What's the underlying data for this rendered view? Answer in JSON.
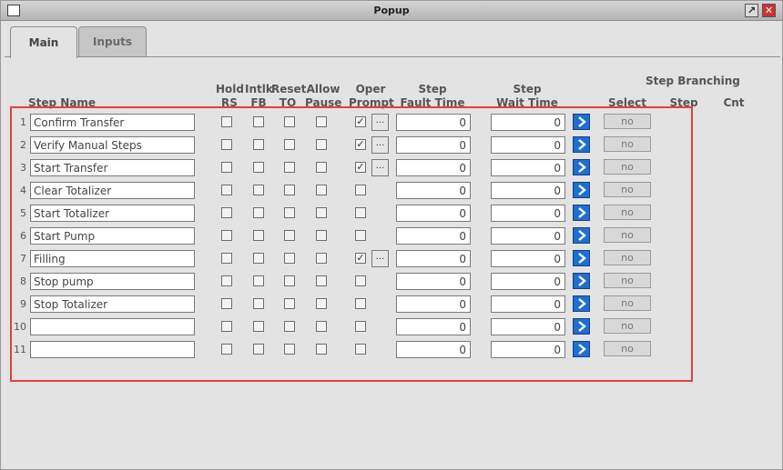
{
  "window": {
    "title": "Popup"
  },
  "tabs": [
    {
      "label": "Main",
      "active": true
    },
    {
      "label": "Inputs",
      "active": false
    }
  ],
  "headers": {
    "step_name": "Step Name",
    "hold": "Hold",
    "rs": "RS",
    "intlk": "Intlk",
    "fb": "FB",
    "reset": "Reset",
    "to": "TO",
    "allow": "Allow",
    "pause": "Pause",
    "oper": "Oper",
    "prompt": "Prompt",
    "step_fault_1": "Step",
    "step_fault_2": "Fault Time",
    "step_wait_1": "Step",
    "step_wait_2": "Wait Time",
    "step_branching": "Step Branching",
    "select": "Select",
    "step": "Step",
    "cnt": "Cnt"
  },
  "rows": [
    {
      "num": "1",
      "name": "Confirm Transfer",
      "oper": true,
      "fault": "0",
      "wait": "0",
      "select": "no"
    },
    {
      "num": "2",
      "name": "Verify Manual Steps",
      "oper": true,
      "fault": "0",
      "wait": "0",
      "select": "no"
    },
    {
      "num": "3",
      "name": "Start Transfer",
      "oper": true,
      "fault": "0",
      "wait": "0",
      "select": "no"
    },
    {
      "num": "4",
      "name": "Clear Totalizer",
      "oper": false,
      "fault": "0",
      "wait": "0",
      "select": "no"
    },
    {
      "num": "5",
      "name": "Start Totalizer",
      "oper": false,
      "fault": "0",
      "wait": "0",
      "select": "no"
    },
    {
      "num": "6",
      "name": "Start Pump",
      "oper": false,
      "fault": "0",
      "wait": "0",
      "select": "no"
    },
    {
      "num": "7",
      "name": "Filling",
      "oper": true,
      "fault": "0",
      "wait": "0",
      "select": "no"
    },
    {
      "num": "8",
      "name": "Stop pump",
      "oper": false,
      "fault": "0",
      "wait": "0",
      "select": "no"
    },
    {
      "num": "9",
      "name": "Stop Totalizer",
      "oper": false,
      "fault": "0",
      "wait": "0",
      "select": "no"
    },
    {
      "num": "10",
      "name": "",
      "oper": false,
      "fault": "0",
      "wait": "0",
      "select": "no"
    },
    {
      "num": "11",
      "name": "",
      "oper": false,
      "fault": "0",
      "wait": "0",
      "select": "no"
    }
  ],
  "colors": {
    "highlight": "#e04040",
    "arrow": "#1e6fd0"
  },
  "icons": {
    "app": "window-icon",
    "maximize": "restore-icon",
    "close": "close-icon",
    "row_button": "chevron-right-icon"
  }
}
